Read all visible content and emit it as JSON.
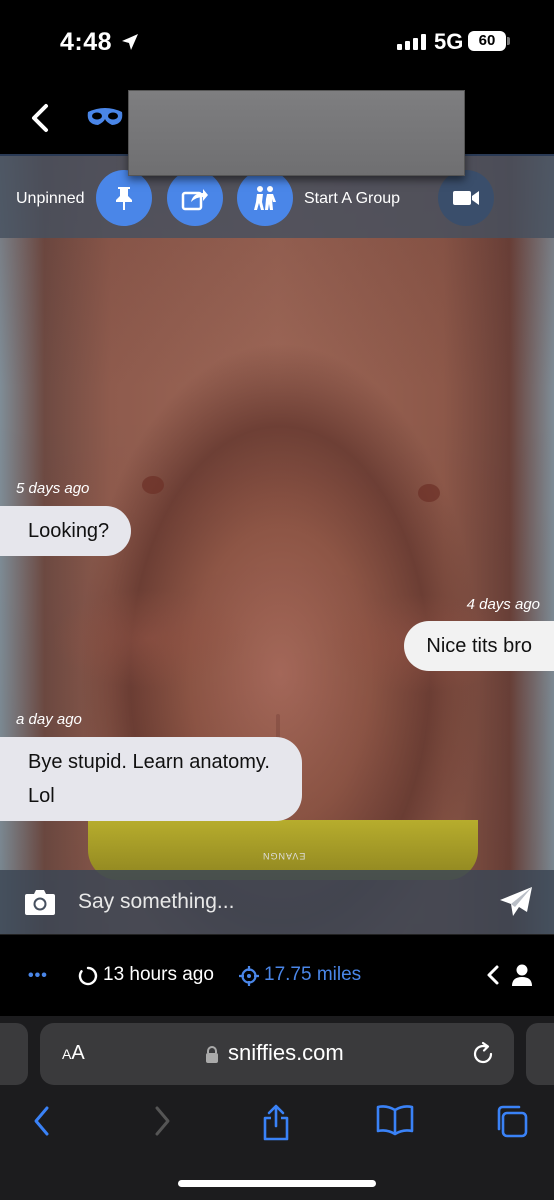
{
  "status_bar": {
    "time": "4:48",
    "network": "5G",
    "battery": "60"
  },
  "toolbar": {
    "unpinned_label": "Unpinned",
    "start_group_label": "Start A Group"
  },
  "messages": [
    {
      "timestamp": "5 days ago",
      "text": "Looking?",
      "direction": "incoming"
    },
    {
      "timestamp": "4 days ago",
      "text": "Nice tits bro",
      "direction": "outgoing"
    },
    {
      "timestamp": "a day ago",
      "line1": "Bye stupid. Learn anatomy.",
      "line2": "Lol",
      "direction": "incoming"
    }
  ],
  "briefs_text": "EVANGN",
  "compose": {
    "placeholder": "Say something..."
  },
  "info_bar": {
    "more": "•••",
    "last_online": "13 hours ago",
    "distance": "17.75 miles"
  },
  "browser": {
    "text_size_label_small": "A",
    "text_size_label_large": "A",
    "url": "sniffies.com"
  },
  "colors": {
    "accent": "#4a86e8",
    "toolbar_bg": "#46505f",
    "bubble_in": "#e6e6ec",
    "bubble_out": "#f2f2f2"
  }
}
